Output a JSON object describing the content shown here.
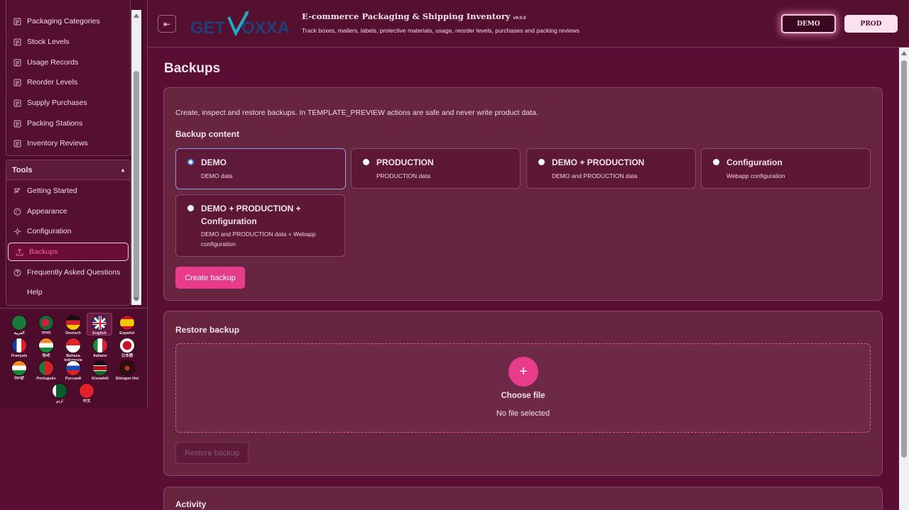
{
  "sidebar": {
    "items": [
      {
        "label": "Packaging Categories",
        "icon": "list-icon"
      },
      {
        "label": "Stock Levels",
        "icon": "list-icon"
      },
      {
        "label": "Usage Records",
        "icon": "list-icon"
      },
      {
        "label": "Reorder Levels",
        "icon": "list-icon"
      },
      {
        "label": "Supply Purchases",
        "icon": "list-icon"
      },
      {
        "label": "Packing Stations",
        "icon": "list-icon"
      },
      {
        "label": "Inventory Reviews",
        "icon": "list-icon"
      }
    ],
    "tools_title": "Tools",
    "tools_toggle": "▴",
    "tools": [
      {
        "label": "Getting Started",
        "icon": "rocket-icon"
      },
      {
        "label": "Appearance",
        "icon": "palette-icon"
      },
      {
        "label": "Configuration",
        "icon": "gear-icon"
      },
      {
        "label": "Backups",
        "icon": "upload-icon"
      },
      {
        "label": "Frequently Asked Questions",
        "icon": "question-icon"
      },
      {
        "label": "Help",
        "icon": ""
      }
    ],
    "languages": [
      {
        "label": "العربية"
      },
      {
        "label": "বাংলা"
      },
      {
        "label": "Deutsch"
      },
      {
        "label": "English"
      },
      {
        "label": "Español"
      },
      {
        "label": "Français"
      },
      {
        "label": "हिन्दी"
      },
      {
        "label": "Bahasa Indonesia"
      },
      {
        "label": "Italiano"
      },
      {
        "label": "日本語"
      },
      {
        "label": "ਪੰਜਾਬੀ"
      },
      {
        "label": "Português"
      },
      {
        "label": "Русский"
      },
      {
        "label": "Kiswahili"
      },
      {
        "label": "Shingon Hoi"
      },
      {
        "label": "اردو"
      },
      {
        "label": "中文"
      }
    ]
  },
  "header": {
    "toggle_icon": "⇤",
    "logo_text_left": "GET",
    "logo_text_right": "OXXA",
    "title": "E-commerce Packaging & Shipping Inventory",
    "version": "v9.0.0",
    "subtitle": "Track boxes, mailers, labels, protective materials, usage, reorder levels, purchases and packing reviews",
    "env_demo": "DEMO",
    "env_prod": "PROD"
  },
  "main": {
    "page_title": "Backups",
    "intro": "Create, inspect and restore backups. In TEMPLATE_PREVIEW actions are safe and never write product data.",
    "backup_content_title": "Backup content",
    "options": [
      {
        "title": "DEMO",
        "desc": "DEMO data"
      },
      {
        "title": "PRODUCTION",
        "desc": "PRODUCTION data"
      },
      {
        "title": "DEMO + PRODUCTION",
        "desc": "DEMO and PRODUCTION data"
      },
      {
        "title": "Configuration",
        "desc": "Webapp configuration"
      },
      {
        "title": "DEMO + PRODUCTION + Configuration",
        "desc": "DEMO and PRODUCTION data + Webapp configuration"
      }
    ],
    "create_button": "Create backup",
    "restore_title": "Restore backup",
    "drop_plus": "+",
    "choose_file": "Choose file",
    "no_file": "No file selected",
    "restore_button": "Restore backup",
    "activity_title": "Activity"
  },
  "colors": {
    "background": "#5a0e33",
    "accent": "#e83c8a",
    "card": "#682540"
  }
}
